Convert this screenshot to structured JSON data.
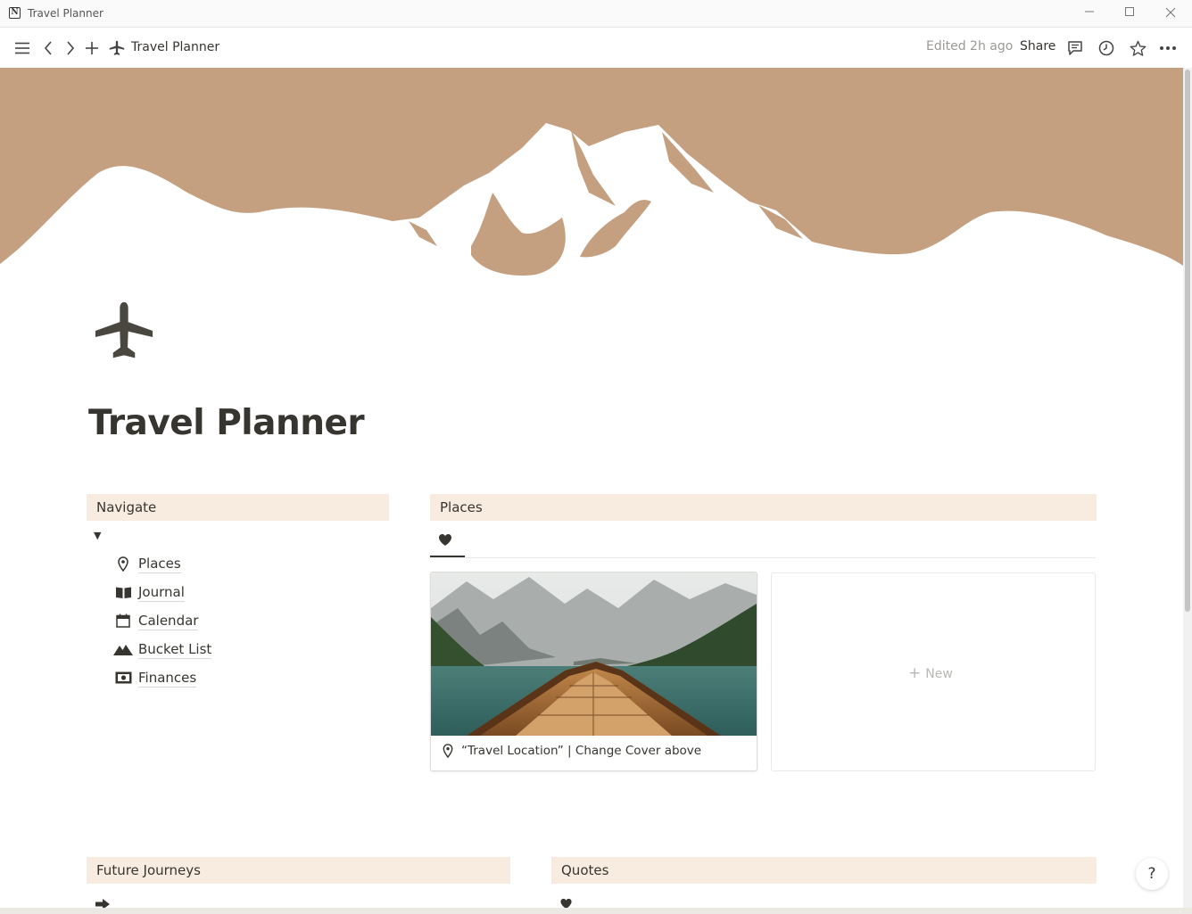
{
  "window": {
    "title": "Travel Planner"
  },
  "topbar": {
    "breadcrumb": "Travel Planner",
    "edited": "Edited 2h ago",
    "share_label": "Share"
  },
  "page": {
    "title": "Travel Planner",
    "icon": "airplane-icon",
    "accent_color": "#c4a080",
    "callout_color": "#f8ece0"
  },
  "navigate": {
    "heading": "Navigate",
    "items": [
      {
        "label": "Places",
        "icon": "map-pin-icon"
      },
      {
        "label": "Journal",
        "icon": "book-icon"
      },
      {
        "label": "Calendar",
        "icon": "calendar-icon"
      },
      {
        "label": "Bucket List",
        "icon": "mountain-icon"
      },
      {
        "label": "Finances",
        "icon": "money-icon"
      }
    ]
  },
  "places": {
    "heading": "Places",
    "view_tab_icon": "heart-icon",
    "card_caption": "“Travel Location” | Change Cover above",
    "new_label": "New"
  },
  "future": {
    "heading": "Future Journeys"
  },
  "quotes": {
    "heading": "Quotes"
  },
  "help_label": "?"
}
